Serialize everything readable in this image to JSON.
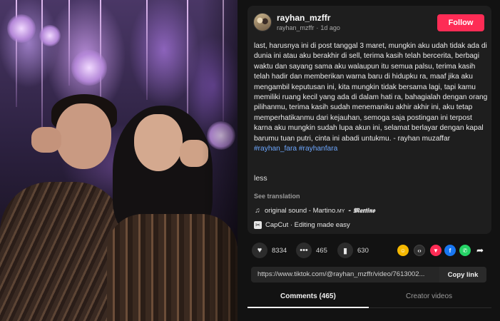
{
  "post": {
    "username": "rayhan_mzffr",
    "handle": "rayhan_mzffr",
    "time_ago": "1d ago",
    "follow_label": "Follow",
    "caption_text": "last, harusnya ini di post tanggal 3 maret, mungkin aku udah tidak ada di dunia ini atau aku berakhir di sell, terima kasih telah bercerita, berbagi waktu dan sayang sama aku walaupun itu semua palsu, terima kasih telah hadir dan memberikan warna baru di hidupku ra, maaf jika aku mengambil keputusan ini, kita mungkin tidak bersama lagi, tapi kamu memiliki ruang kecil yang ada di dalam hati ra, bahagialah dengan orang pilihanmu, terima kasih sudah menemaniku akhir akhir ini, aku tetap memperhatikanmu dari kejauhan, semoga saja postingan ini terpost karna aku mungkin sudah lupa akun ini, selamat berlayar dengan kapal barumu tuan putri, cinta ini abadi untukmu. - rayhan muzaffar",
    "hashtags": [
      "#rayhan_fara",
      "#rayhanfara"
    ],
    "less_label": "less",
    "see_translation": "See translation",
    "sound_label": "original sound - Martino.",
    "sound_suffix": "MY",
    "sound_script": "- 𝕸𝖆𝖗𝖙𝖎𝖓𝖔",
    "capcut_label": "CapCut · Editing made easy"
  },
  "actions": {
    "likes": "8334",
    "comments": "465",
    "saves": "630",
    "like_icon": "heart-icon",
    "comment_icon": "comment-icon",
    "save_icon": "bookmark-icon"
  },
  "share": {
    "icons": [
      "friends-icon",
      "embed-icon",
      "send-icon",
      "facebook-icon",
      "whatsapp-icon",
      "share-arrow-icon"
    ],
    "colors": {
      "friends": "#f5b800",
      "embed": "#2e2e2e",
      "send": "#fe2c55",
      "facebook": "#1877f2",
      "whatsapp": "#25d366"
    }
  },
  "link": {
    "url": "https://www.tiktok.com/@rayhan_mzffr/video/7613002...",
    "copy_label": "Copy link"
  },
  "tabs": {
    "comments_label": "Comments (465)",
    "creator_label": "Creator videos"
  },
  "colors": {
    "accent": "#fe2c55",
    "hashtag": "#6ea8ff",
    "background": "#121212",
    "card": "#1e1e1e"
  }
}
